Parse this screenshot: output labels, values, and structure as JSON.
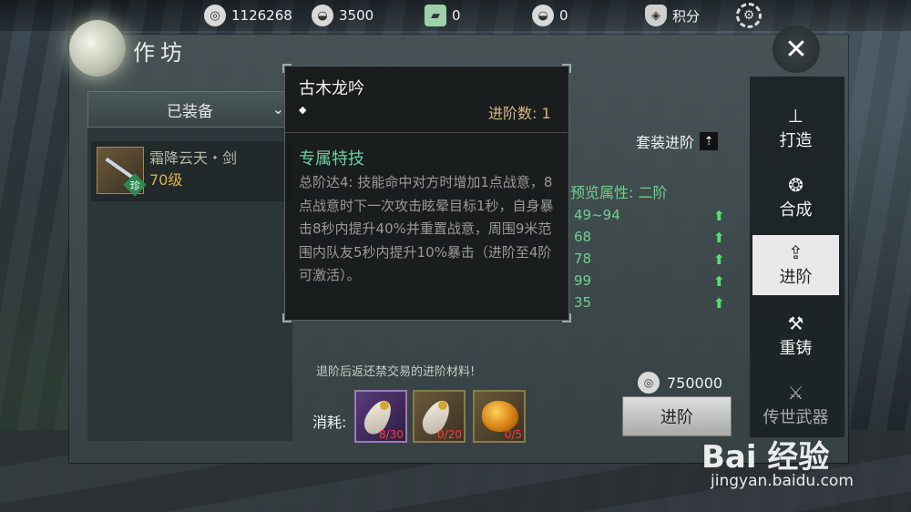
{
  "currencies": [
    {
      "icon": "coin-icon",
      "value": "1126268"
    },
    {
      "icon": "silver-ingot-icon",
      "value": "3500"
    },
    {
      "icon": "jade-ticket-icon",
      "value": "0"
    },
    {
      "icon": "gold-ingot-icon",
      "value": "0"
    },
    {
      "icon": "shield-icon",
      "value": "积分"
    }
  ],
  "header": {
    "title": "作坊",
    "close_label": "✕"
  },
  "left_panel": {
    "dropdown_label": "已装备",
    "item": {
      "name": "霜降云天・剑",
      "level": "70级",
      "badge": "珍"
    }
  },
  "tooltip": {
    "name": "古木龙吟",
    "grade_label": "进阶数: 1",
    "skill_title": "专属特技",
    "skill_desc": "总阶达4: 技能命中对方时增加1点战意，8点战意时下一次攻击眩晕目标1秒，自身暴击8秒内提升40%并重置战意，周围9米范围内队友5秒内提升10%暴击（进阶至4阶可激活）。"
  },
  "detail": {
    "set_advance_label": "套装进阶",
    "preview_title": "预览属性: 二阶",
    "stats": [
      "49~94",
      "68",
      "78",
      "99",
      "35"
    ],
    "hint": "退阶后返还禁交易的进阶材料!",
    "cost": "750000",
    "advance_button": "进阶",
    "consume_label": "消耗:",
    "materials": [
      {
        "name": "peacock-feather-purple",
        "count": "8/30"
      },
      {
        "name": "peacock-feather-gold",
        "count": "0/20"
      },
      {
        "name": "amber-stone",
        "count": "0/5"
      }
    ]
  },
  "side_tabs": [
    {
      "label": "打造",
      "icon": "anvil-icon"
    },
    {
      "label": "合成",
      "icon": "merge-icon"
    },
    {
      "label": "进阶",
      "icon": "upgrade-icon"
    },
    {
      "label": "重铸",
      "icon": "hammer-icon"
    },
    {
      "label": "传世武器",
      "icon": "legend-weapon-icon"
    }
  ],
  "watermark": {
    "brand": "Bai 经验",
    "url": "jingyan.baidu.com"
  },
  "colors": {
    "stat_green": "#6fd08a",
    "level_gold": "#e0b040",
    "skill_green": "#6fd0a0",
    "count_red": "#ff3a3a"
  }
}
